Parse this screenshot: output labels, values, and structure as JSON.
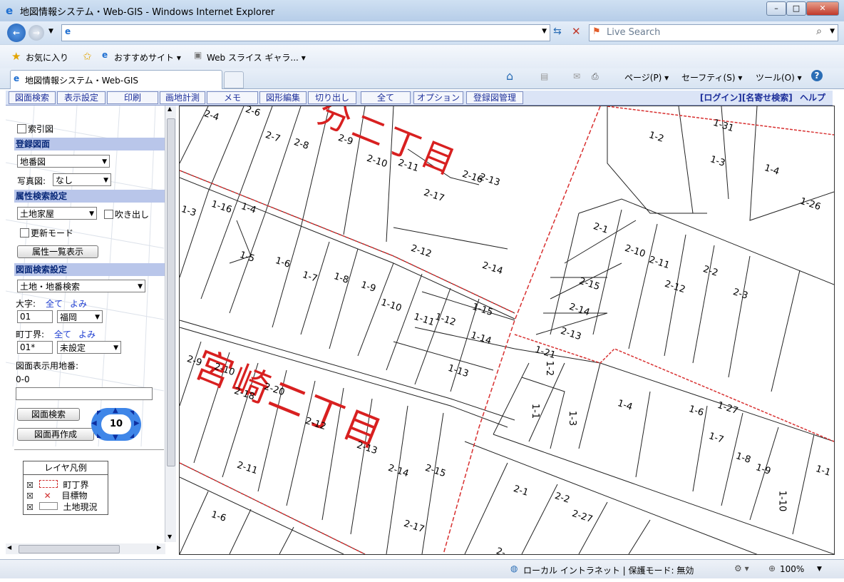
{
  "window": {
    "title": "地図情報システム・Web-GIS - Windows Internet Explorer"
  },
  "nav": {
    "search_placeholder": "Live Search"
  },
  "favbar": {
    "favorites": "お気に入り",
    "suggested": "おすすめサイト ▾",
    "slice": "Web スライス ギャラ... ▾"
  },
  "tab": {
    "title": "地図情報システム・Web-GIS"
  },
  "commandbar": {
    "page": "ページ(P) ▾",
    "safety": "セーフティ(S) ▾",
    "tools": "ツール(O) ▾"
  },
  "menu": {
    "items": [
      "図面検索",
      "表示設定",
      "印刷",
      "画地計測",
      "メモ",
      "図形編集",
      "切り出し",
      "全て",
      "オプション",
      "登録図管理"
    ],
    "right": {
      "login": "[ログイン]",
      "name_search": "[名寄せ検索]",
      "help": "ヘルプ"
    }
  },
  "sidebar": {
    "index_map": "索引図",
    "registered_header": "登録図面",
    "map_select": "地番図",
    "photo_label": "写真図:",
    "photo_select": "なし",
    "attr_header": "属性検索設定",
    "attr_select": "土地家屋",
    "balloon": "吹き出し",
    "update_mode": "更新モード",
    "attr_list_button": "属性一覧表示",
    "map_search_header": "図面検索設定",
    "search_type": "土地・地番検索",
    "oaza_label": "大字:",
    "oaza_all": "全て",
    "oaza_yomi": "よみ",
    "oaza_code": "01",
    "oaza_select": "福岡",
    "chome_label": "町丁界:",
    "chome_all": "全て",
    "chome_yomi": "よみ",
    "chome_code": "01*",
    "chome_select": "未設定",
    "display_lot_label": "図面表示用地番:",
    "display_lot_value": "0-0",
    "lot_input": "",
    "search_button": "図面検索",
    "regen_button": "図面再作成",
    "zoom_level": "10"
  },
  "legend": {
    "title": "レイヤ凡例",
    "items": [
      "町丁界",
      "目標物",
      "土地現況"
    ]
  },
  "map": {
    "labels_big": [
      "宮崎二丁目",
      "分二丁目"
    ],
    "lots": [
      "2-4",
      "2-6",
      "2-7",
      "2-8",
      "2-9",
      "2-10",
      "2-11",
      "2-16",
      "2-13",
      "2-17",
      "1-2",
      "1-31",
      "1-3",
      "1-4",
      "1-26",
      "1-3",
      "1-16",
      "1-4",
      "2-12",
      "2-14",
      "2-1",
      "2-10",
      "2-11",
      "2-2",
      "2-3",
      "2-15",
      "2-12",
      "1-5",
      "1-6",
      "1-7",
      "1-8",
      "1-9",
      "1-10",
      "1-11",
      "1-12",
      "1-15",
      "1-14",
      "1-13",
      "2-14",
      "2-13",
      "2-9",
      "2-10",
      "2-18",
      "2-20",
      "1-21",
      "1-2",
      "1-1",
      "1-3",
      "1-4",
      "1-6",
      "1-27",
      "1-7",
      "1-9",
      "1-8",
      "1-10",
      "1-1",
      "2-12",
      "2-13",
      "2-11",
      "2-14",
      "2-15",
      "1-6",
      "2-17",
      "2-1",
      "2-2",
      "2-27",
      "2-"
    ]
  },
  "status": {
    "zone": "ローカル イントラネット | 保護モード: 無効",
    "zoom": "100%"
  }
}
